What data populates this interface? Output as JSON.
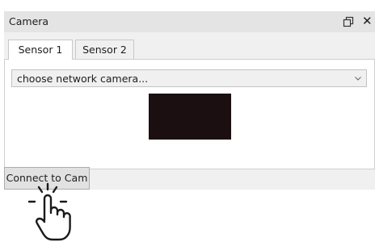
{
  "window": {
    "title": "Camera",
    "float_icon": "float-window-icon",
    "close_glyph": "✕"
  },
  "tabs": [
    {
      "label": "Sensor 1",
      "active": true
    },
    {
      "label": "Sensor 2",
      "active": false
    }
  ],
  "camera_select": {
    "value": "choose network camera...",
    "icon": "chevron-down-icon"
  },
  "preview": {
    "fill_color": "#1b0f12"
  },
  "connect_button": {
    "label": "Connect to Cam"
  },
  "annotation": {
    "icon": "hand-click-icon"
  }
}
